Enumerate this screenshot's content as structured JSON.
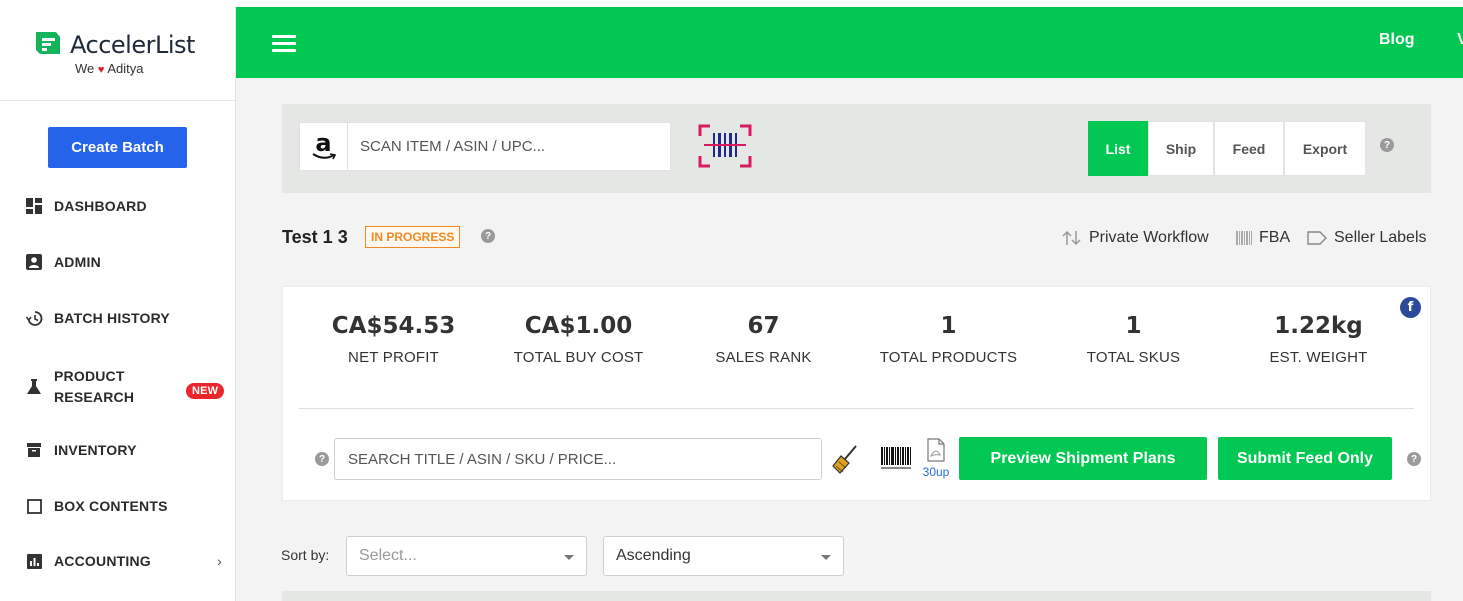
{
  "brand": {
    "name": "AccelerList",
    "tagline_prefix": "We",
    "tagline_heart": "♥",
    "tagline_name": "Aditya"
  },
  "sidebar": {
    "create_label": "Create Batch",
    "items": [
      {
        "label": "DASHBOARD",
        "icon": "dashboard-icon"
      },
      {
        "label": "ADMIN",
        "icon": "user-box-icon"
      },
      {
        "label": "BATCH HISTORY",
        "icon": "history-icon"
      },
      {
        "label": "PRODUCT",
        "label2": "RESEARCH",
        "icon": "flask-icon",
        "badge": "NEW"
      },
      {
        "label": "INVENTORY",
        "icon": "archive-icon"
      },
      {
        "label": "BOX CONTENTS",
        "icon": "square-icon"
      },
      {
        "label": "ACCOUNTING",
        "icon": "bar-chart-icon",
        "chevron": "›"
      }
    ]
  },
  "topbar": {
    "blog_label": "Blog",
    "cut_label": "V"
  },
  "scan": {
    "placeholder": "SCAN ITEM / ASIN / UPC...",
    "amazon_glyph": "a"
  },
  "modes": {
    "list": "List",
    "ship": "Ship",
    "feed": "Feed",
    "export": "Export",
    "help": "?"
  },
  "batch": {
    "title": "Test 1 3",
    "status": "IN PROGRESS",
    "workflow_label": "Private Workflow",
    "fba_label": "FBA",
    "seller_labels": "Seller Labels"
  },
  "stats": [
    {
      "value": "CA$54.53",
      "label": "NET PROFIT"
    },
    {
      "value": "CA$1.00",
      "label": "TOTAL BUY COST"
    },
    {
      "value": "67",
      "label": "SALES RANK"
    },
    {
      "value": "1",
      "label": "TOTAL PRODUCTS"
    },
    {
      "value": "1",
      "label": "TOTAL SKUS"
    },
    {
      "value": "1.22kg",
      "label": "EST. WEIGHT"
    }
  ],
  "facebook": "f",
  "search": {
    "placeholder": "SEARCH TITLE / ASIN / SKU / PRICE..."
  },
  "labels": {
    "pdf_label": "30up"
  },
  "actions": {
    "preview": "Preview Shipment Plans",
    "submit": "Submit Feed Only"
  },
  "sort": {
    "label": "Sort by:",
    "field_placeholder": "Select...",
    "order": "Ascending"
  },
  "colors": {
    "green": "#00c853",
    "blue": "#2563eb",
    "badge_red": "#e8262b",
    "status_orange": "#f08a24"
  }
}
